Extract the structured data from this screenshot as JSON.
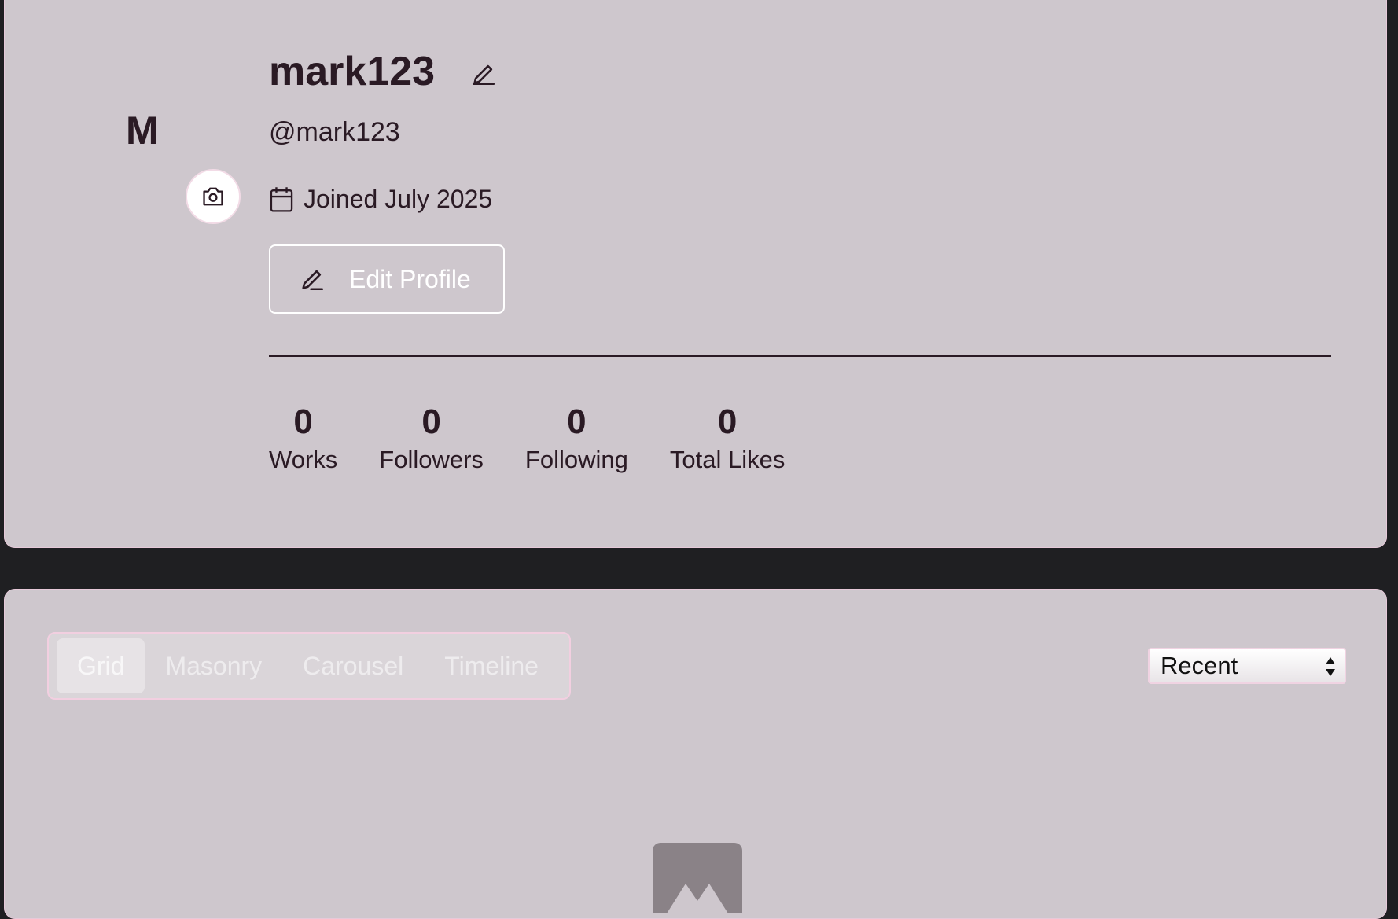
{
  "profile": {
    "avatar_initial": "M",
    "username": "mark123",
    "handle": "@mark123",
    "joined": "Joined July 2025",
    "edit_profile_label": "Edit Profile",
    "stats": [
      {
        "value": "0",
        "label": "Works"
      },
      {
        "value": "0",
        "label": "Followers"
      },
      {
        "value": "0",
        "label": "Following"
      },
      {
        "value": "0",
        "label": "Total Likes"
      }
    ]
  },
  "gallery": {
    "tabs": [
      {
        "label": "Grid",
        "active": true
      },
      {
        "label": "Masonry",
        "active": false
      },
      {
        "label": "Carousel",
        "active": false
      },
      {
        "label": "Timeline",
        "active": false
      }
    ],
    "sort": {
      "selected": "Recent"
    }
  },
  "icons": {
    "camera": "camera-icon",
    "edit": "pencil-icon",
    "calendar": "calendar-icon",
    "empty": "image-placeholder-icon"
  },
  "colors": {
    "card_bg": "#cec7cd",
    "page_bg": "#1f1f22",
    "text": "#2a1a24",
    "accent_border": "#f2cfe0"
  }
}
